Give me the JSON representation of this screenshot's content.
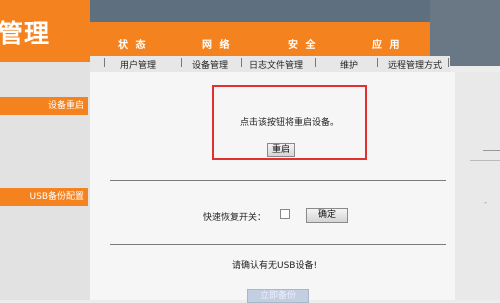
{
  "header": {
    "logo_text": "管理"
  },
  "menu": {
    "items": [
      "状 态",
      "网 络",
      "安 全",
      "应 用"
    ]
  },
  "submenu": {
    "items": [
      "用户管理",
      "设备管理",
      "日志文件管理",
      "维护",
      "远程管理方式"
    ]
  },
  "sidebar": {
    "sections": [
      "设备重启",
      "USB备份配置"
    ]
  },
  "restart": {
    "message": "点击该按钮将重启设备。",
    "button_label": "重启"
  },
  "usb_backup": {
    "quick_restore_label": "快速恢复开关：",
    "confirm_label": "确定",
    "status_message": "请确认有无USB设备!",
    "backup_button_label": "立即备份"
  }
}
